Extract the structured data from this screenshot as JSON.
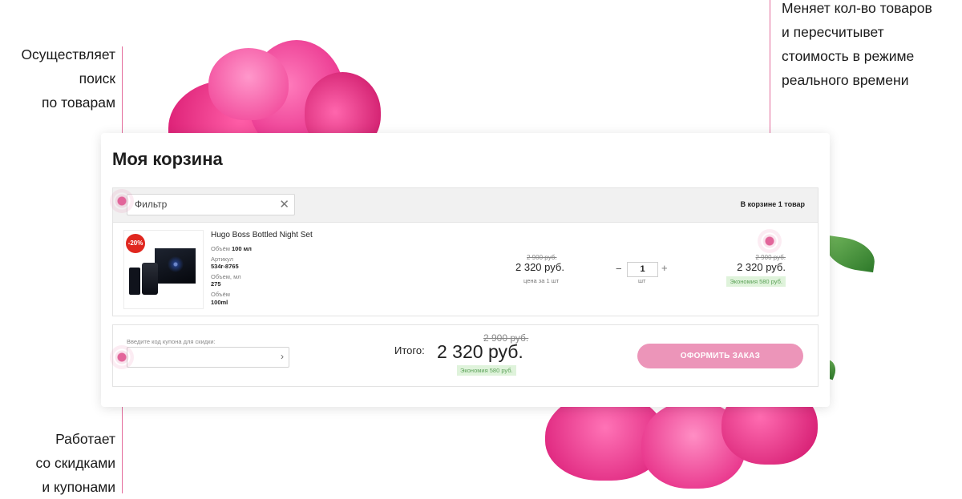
{
  "annotations": {
    "search": [
      "Осуществляет",
      "поиск",
      "по товарам"
    ],
    "quantity": [
      "Меняет кол-во товаров",
      "и пересчитывет",
      "стоимость в режиме",
      "реального времени"
    ],
    "coupons": [
      "Работает",
      "со скидками",
      "и купонами"
    ]
  },
  "cart": {
    "title": "Моя корзина",
    "filter_text": "Фильтр",
    "count_label": "В корзине 1 товар",
    "item": {
      "discount_badge": "-20%",
      "name": "Hugo Boss Bottled Night Set",
      "volume_label": "Объём",
      "volume_value": "100 мл",
      "article_label": "Артикул",
      "article_value": "534r-8765",
      "volume_ml_label": "Объем, мл",
      "volume_ml_value": "275",
      "volume2_label": "Объём",
      "volume2_value": "100ml",
      "old_unit_price": "2 900 руб.",
      "unit_price": "2 320 руб.",
      "unit_caption": "цена за 1 шт",
      "quantity": "1",
      "quantity_unit": "шт",
      "old_row_total": "2 900 руб.",
      "row_total": "2 320 руб.",
      "row_savings": "Экономия 580 руб."
    },
    "footer": {
      "coupon_label": "Введите код купона для скидки:",
      "total_label": "Итого:",
      "old_total": "2 900 руб.",
      "total": "2 320 руб.",
      "savings": "Экономия 580 руб.",
      "checkout_label": "ОФОРМИТЬ ЗАКАЗ"
    }
  },
  "colors": {
    "accent": "#ec95b9",
    "marker": "#e2659a",
    "badge": "#e0271f",
    "savings_bg": "#dff3db",
    "savings_text": "#5ea35a"
  }
}
